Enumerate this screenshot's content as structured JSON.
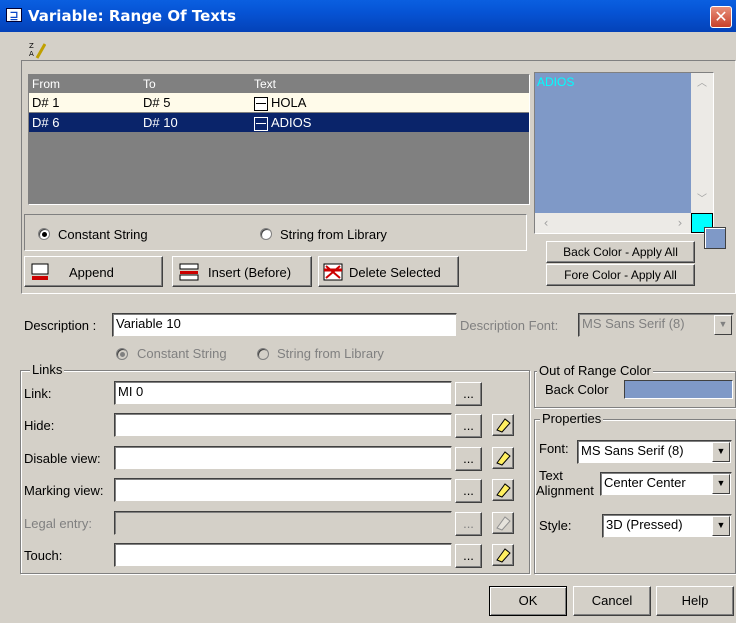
{
  "window": {
    "title": "Variable: Range Of Texts",
    "close": "✕"
  },
  "grid": {
    "columns": [
      "From",
      "To",
      "Text"
    ],
    "rows": [
      {
        "from": "D# 1",
        "to": "D# 5",
        "text": "HOLA"
      },
      {
        "from": "D# 6",
        "to": "D# 10",
        "text": "ADIOS"
      }
    ]
  },
  "preview": {
    "text": "ADIOS",
    "back_color": "#7f99c7",
    "fore_color": "#00ffff"
  },
  "string_source": {
    "constant": "Constant String",
    "library": "String from Library",
    "selected": "constant"
  },
  "buttons": {
    "append": "Append",
    "insert": "Insert (Before)",
    "delete": "Delete Selected",
    "back_color_all": "Back Color - Apply All",
    "fore_color_all": "Fore Color - Apply All",
    "ok": "OK",
    "cancel": "Cancel",
    "help": "Help",
    "browse": "..."
  },
  "description": {
    "label": "Description :",
    "value": "Variable 10",
    "font_label": "Description Font:",
    "font_value": "MS Sans Serif (8)"
  },
  "desc_source": {
    "constant": "Constant String",
    "library": "String from Library"
  },
  "links": {
    "group_label": "Links",
    "link": {
      "label": "Link:",
      "value": "MI 0"
    },
    "hide": {
      "label": "Hide:",
      "value": ""
    },
    "disable_view": {
      "label": "Disable view:",
      "value": ""
    },
    "marking_view": {
      "label": "Marking view:",
      "value": ""
    },
    "legal_entry": {
      "label": "Legal entry:",
      "value": ""
    },
    "touch": {
      "label": "Touch:",
      "value": ""
    }
  },
  "out_of_range": {
    "group_label": "Out of Range Color",
    "back_color_label": "Back Color",
    "color": "#7f99c7"
  },
  "properties": {
    "group_label": "Properties",
    "font_label": "Font:",
    "font_value": "MS Sans Serif (8)",
    "alignment_label_1": "Text",
    "alignment_label_2": "Alignment",
    "alignment_value": "Center Center",
    "style_label": "Style:",
    "style_value": "3D (Pressed)"
  }
}
